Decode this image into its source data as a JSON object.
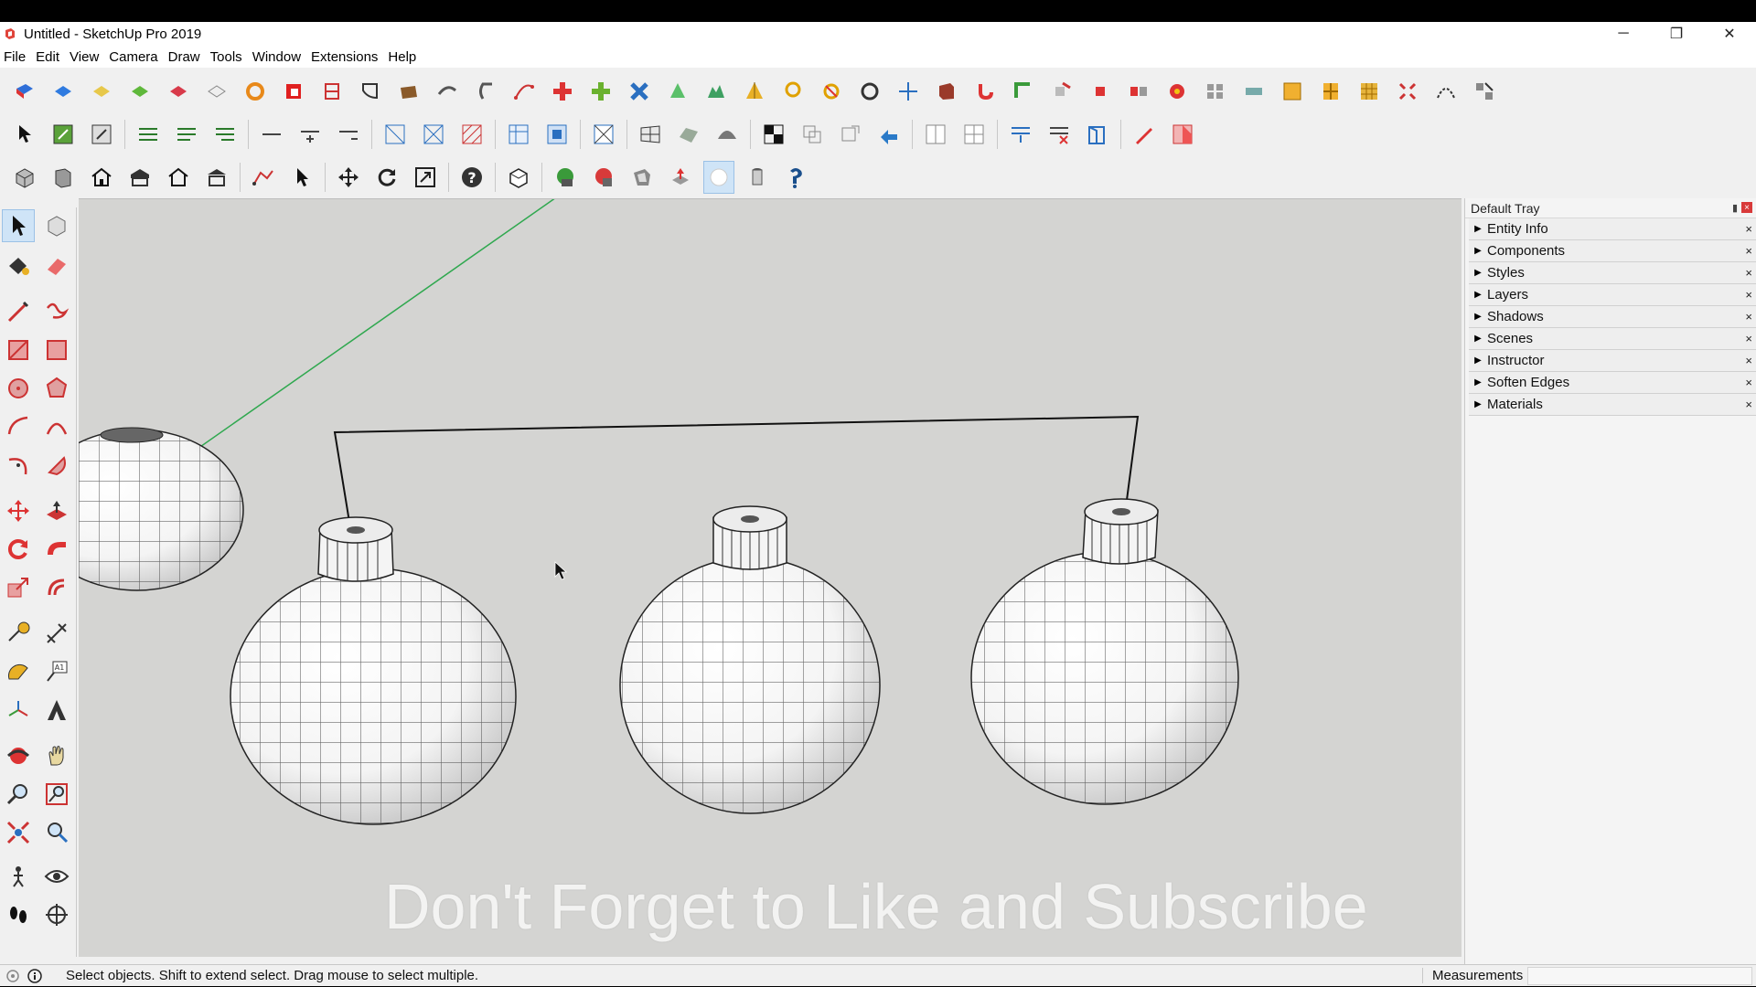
{
  "window": {
    "title": "Untitled - SketchUp Pro 2019",
    "controls": {
      "minimize": "─",
      "restore": "❐",
      "close": "✕"
    }
  },
  "menu": {
    "items": [
      "File",
      "Edit",
      "View",
      "Camera",
      "Draw",
      "Tools",
      "Window",
      "Extensions",
      "Help"
    ]
  },
  "colors": {
    "viewport_bg": "#d4d4d2",
    "axis_green": "#2fa84f",
    "tray_close": "#d83a3a"
  },
  "tray": {
    "title": "Default Tray",
    "panels": [
      "Entity Info",
      "Components",
      "Styles",
      "Layers",
      "Shadows",
      "Scenes",
      "Instructor",
      "Soften Edges",
      "Materials"
    ]
  },
  "status": {
    "text": "Select objects. Shift to extend select. Drag mouse to select multiple.",
    "measurements_label": "Measurements",
    "measurements_value": ""
  },
  "overlay": {
    "subtitle": "Don't Forget to Like and Subscribe"
  },
  "left_tools": [
    "select-tool-icon",
    "component-tool-icon",
    "paint-bucket-icon",
    "eraser-icon",
    "line-tool-icon",
    "freehand-tool-icon",
    "rectangle-tool-icon",
    "rotated-rectangle-icon",
    "circle-tool-icon",
    "polygon-tool-icon",
    "arc-tool-icon",
    "two-point-arc-icon",
    "three-point-arc-icon",
    "pie-tool-icon",
    "move-tool-icon",
    "push-pull-icon",
    "rotate-tool-icon",
    "follow-me-icon",
    "scale-tool-icon",
    "offset-tool-icon",
    "tape-measure-icon",
    "dimension-tool-icon",
    "protractor-icon",
    "text-tool-icon",
    "axes-tool-icon",
    "3d-text-icon",
    "orbit-tool-icon",
    "pan-tool-icon",
    "zoom-tool-icon",
    "zoom-window-icon",
    "zoom-extents-icon",
    "previous-view-icon",
    "position-camera-icon",
    "look-around-icon",
    "walk-tool-icon",
    "section-plane-icon"
  ]
}
